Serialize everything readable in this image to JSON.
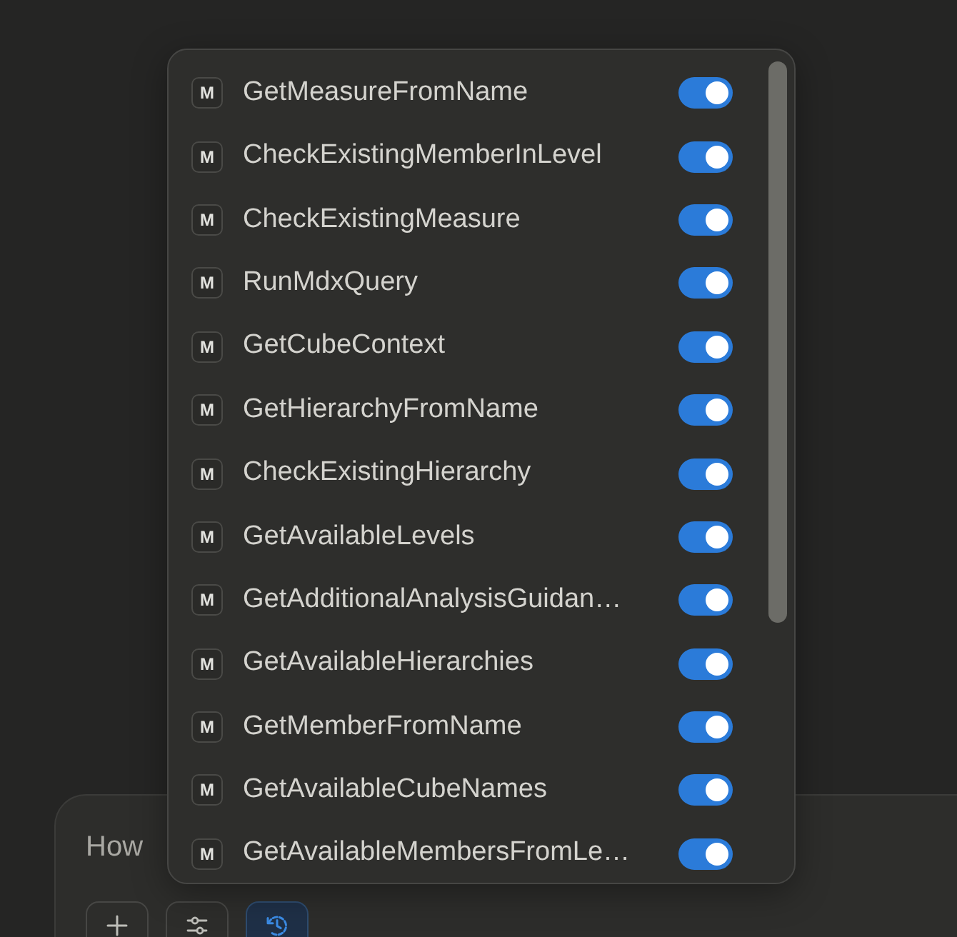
{
  "tools_menu": {
    "tools": [
      {
        "badge": "M",
        "name": "GetMeasureFromName",
        "enabled": true
      },
      {
        "badge": "M",
        "name": "CheckExistingMemberInLevel",
        "enabled": true
      },
      {
        "badge": "M",
        "name": "CheckExistingMeasure",
        "enabled": true
      },
      {
        "badge": "M",
        "name": "RunMdxQuery",
        "enabled": true
      },
      {
        "badge": "M",
        "name": "GetCubeContext",
        "enabled": true
      },
      {
        "badge": "M",
        "name": "GetHierarchyFromName",
        "enabled": true
      },
      {
        "badge": "M",
        "name": "CheckExistingHierarchy",
        "enabled": true
      },
      {
        "badge": "M",
        "name": "GetAvailableLevels",
        "enabled": true
      },
      {
        "badge": "M",
        "name": "GetAdditionalAnalysisGuidan…",
        "enabled": true
      },
      {
        "badge": "M",
        "name": "GetAvailableHierarchies",
        "enabled": true
      },
      {
        "badge": "M",
        "name": "GetMemberFromName",
        "enabled": true
      },
      {
        "badge": "M",
        "name": "GetAvailableCubeNames",
        "enabled": true
      },
      {
        "badge": "M",
        "name": "GetAvailableMembersFromLe…",
        "enabled": true
      }
    ]
  },
  "composer": {
    "placeholder": "How",
    "toolbar_buttons": [
      {
        "kind": "plus",
        "active": false
      },
      {
        "kind": "sliders",
        "active": false
      },
      {
        "kind": "clock",
        "active": true
      }
    ]
  }
}
